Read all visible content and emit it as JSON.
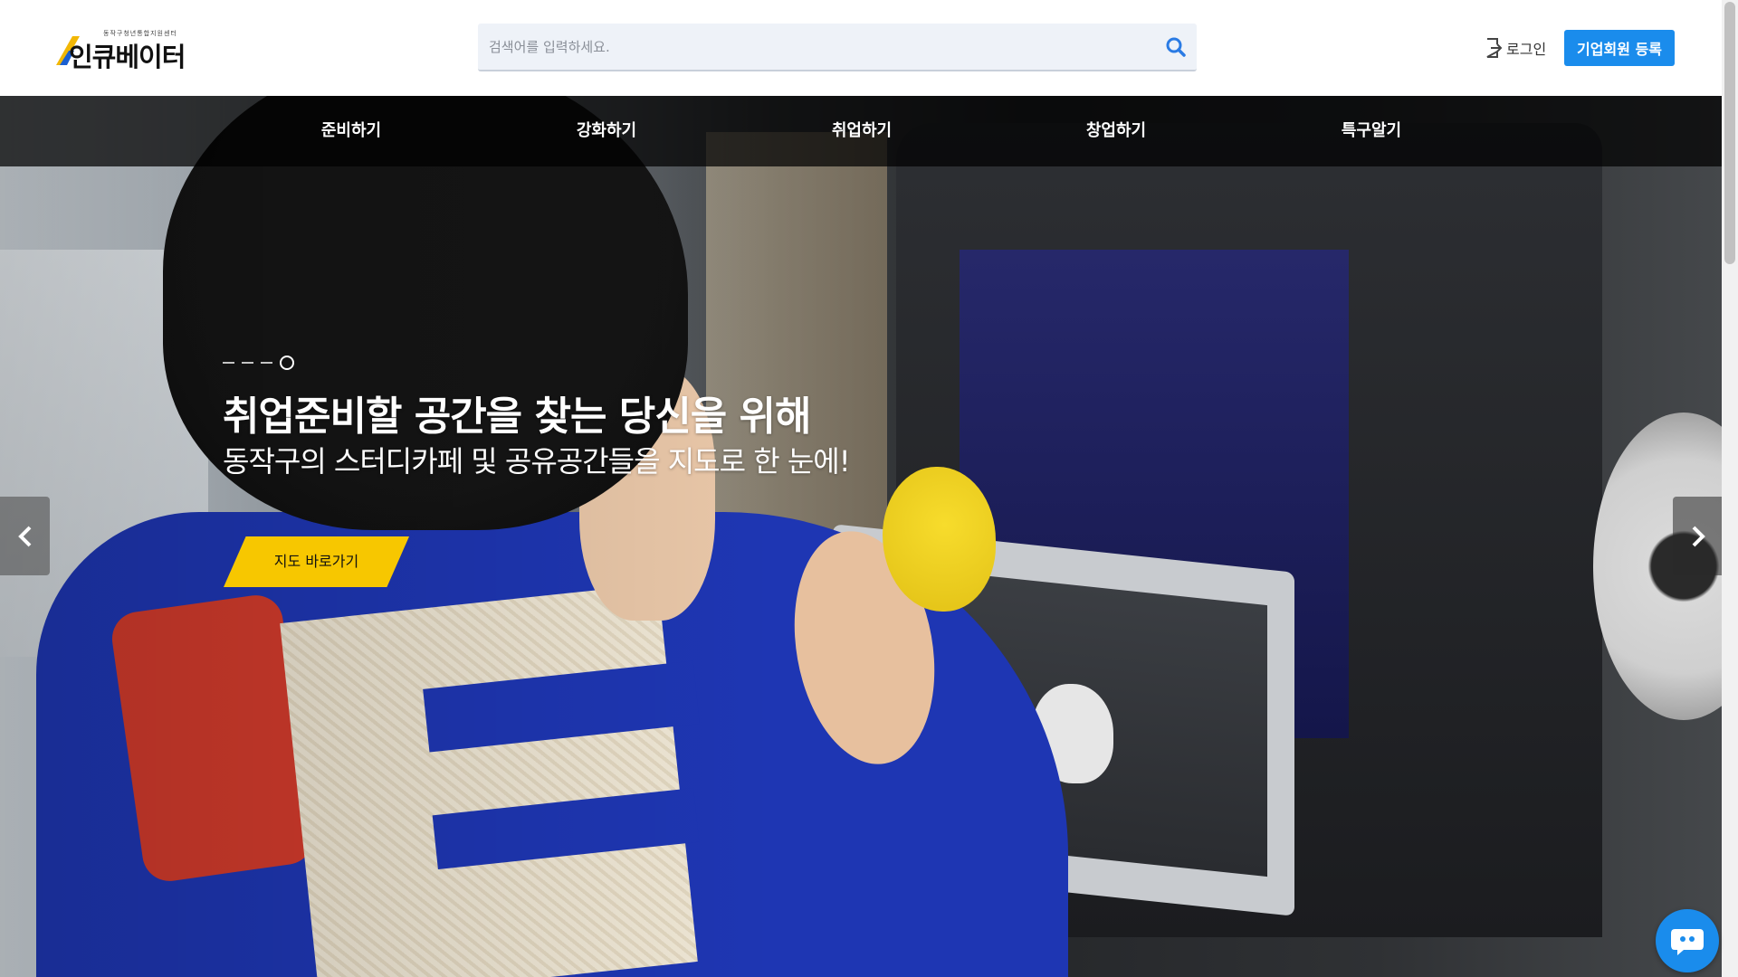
{
  "header": {
    "logo_sub": "동작구청년통합지원센터",
    "logo_text": "인큐베이터",
    "search_placeholder": "검색어를 입력하세요.",
    "login_label": "로그인",
    "register_label": "기업회원 등록"
  },
  "nav": {
    "items": [
      {
        "label": "준비하기"
      },
      {
        "label": "강화하기"
      },
      {
        "label": "취업하기"
      },
      {
        "label": "창업하기"
      },
      {
        "label": "특구알기"
      }
    ]
  },
  "slide": {
    "title": "취업준비할 공간을 찾는 당신을 위해",
    "subtitle": "동작구의 스터디카페 및 공유공간들을 지도로 한 눈에!",
    "cta_label": "지도 바로가기",
    "indicator_count": 4,
    "active_index": 3
  },
  "colors": {
    "accent": "#1a8cec",
    "cta": "#f7c700",
    "nav_bg": "#000000"
  },
  "icons": {
    "search": "search-icon",
    "login": "login-icon",
    "prev": "chevron-left-icon",
    "next": "chevron-right-icon",
    "chat": "chat-icon"
  }
}
